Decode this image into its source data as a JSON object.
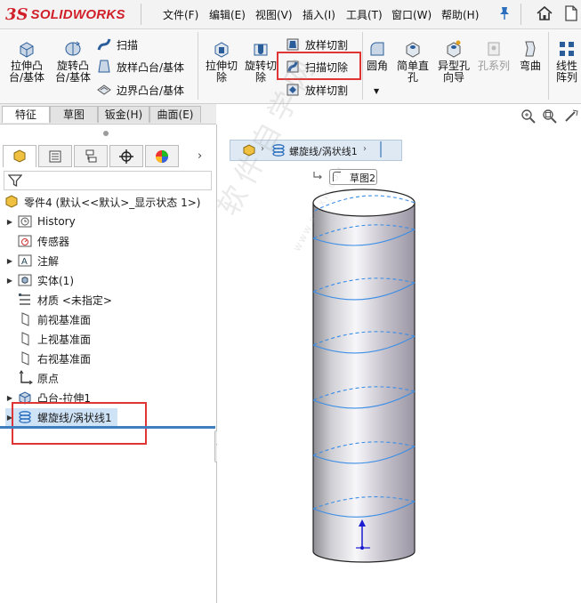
{
  "app": {
    "brand": "SOLIDWORKS",
    "brand_prefix": "3S"
  },
  "menu": {
    "items": [
      {
        "label": "文件(F)"
      },
      {
        "label": "编辑(E)"
      },
      {
        "label": "视图(V)"
      },
      {
        "label": "插入(I)"
      },
      {
        "label": "工具(T)"
      },
      {
        "label": "窗口(W)"
      },
      {
        "label": "帮助(H)"
      }
    ]
  },
  "ribbon": {
    "extrude_boss": "拉伸凸台/基体",
    "revolve_boss": "旋转凸台/基体",
    "sweep": "扫描",
    "loft_boss": "放样凸台/基体",
    "boundary_boss": "边界凸台/基体",
    "extrude_cut": "拉伸切除",
    "revolve_cut": "旋转切除",
    "loft_cut": "放样切割",
    "sweep_cut": "扫描切除",
    "boundary_cut": "放样切割",
    "fillet": "圆角",
    "simple_hole": "简单直孔",
    "hole_wizard": "异型孔向导",
    "hole_series": "孔系列",
    "flex": "弯曲",
    "linear_pattern": "线性阵列"
  },
  "tabs": [
    {
      "label": "特征"
    },
    {
      "label": "草图"
    },
    {
      "label": "钣金(H)"
    },
    {
      "label": "曲面(E)"
    }
  ],
  "tree": {
    "root": "零件4 (默认<<默认>_显示状态 1>)",
    "items": [
      {
        "label": "History"
      },
      {
        "label": "传感器"
      },
      {
        "label": "注解"
      },
      {
        "label": "实体(1)"
      },
      {
        "label": "材质 <未指定>"
      },
      {
        "label": "前视基准面"
      },
      {
        "label": "上视基准面"
      },
      {
        "label": "右视基准面"
      },
      {
        "label": "原点"
      },
      {
        "label": "凸台-拉伸1"
      },
      {
        "label": "螺旋线/涡状线1"
      }
    ]
  },
  "viewport": {
    "breadcrumb": "螺旋线/涡状线1",
    "sketch_label": "草图2",
    "watermark": "软件自学网",
    "watermark_url": "WWW.RJZXW.COM"
  },
  "colors": {
    "accent_red": "#e03535",
    "selection_blue": "#cfe3f7",
    "helix_blue": "#3c8ee6",
    "brand_red": "#d11f2a"
  }
}
